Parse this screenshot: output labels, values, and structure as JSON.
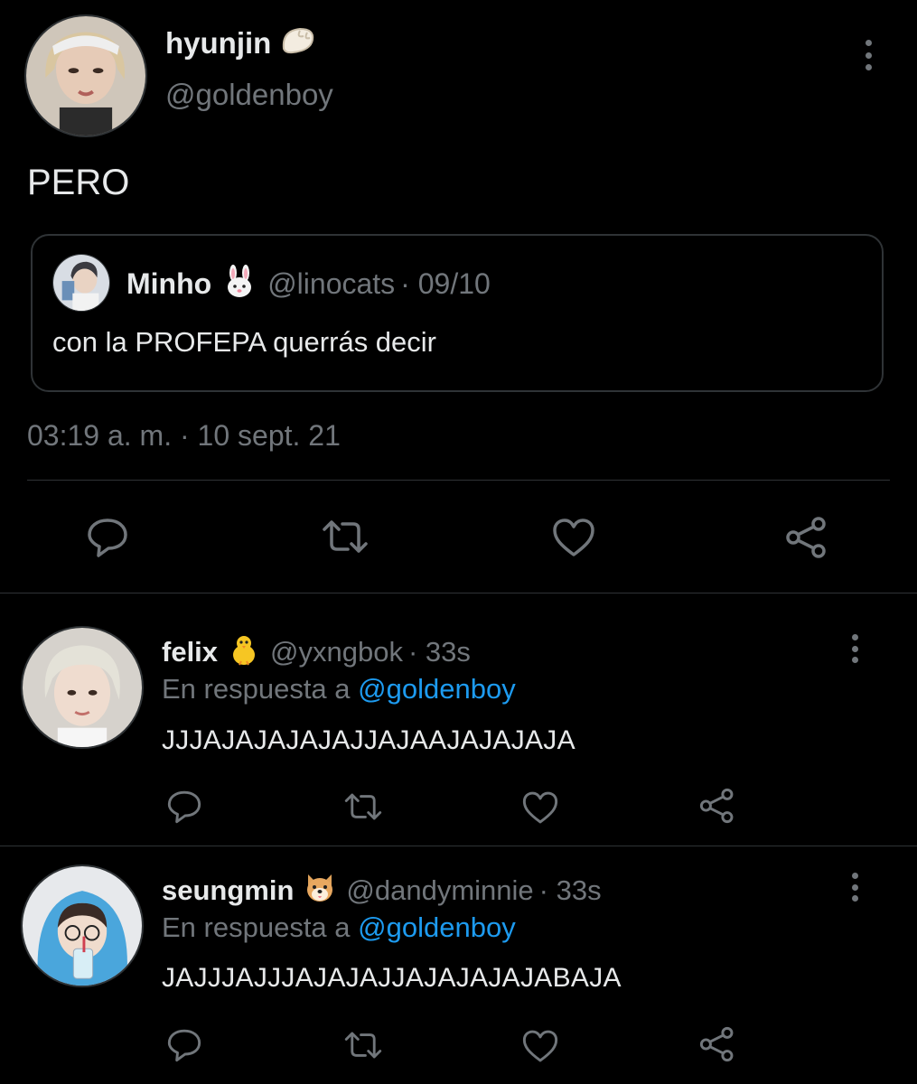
{
  "main_tweet": {
    "display_name": "hyunjin",
    "name_emoji": "dumpling",
    "handle": "@goldenboy",
    "text": "PERO",
    "quote": {
      "display_name": "Minho",
      "name_emoji": "rabbit-face",
      "handle": "@linocats",
      "date": "· 09/10",
      "text": "con la PROFEPA querrás decir"
    },
    "timestamp": "03:19 a. m. · 10 sept. 21",
    "actions": [
      "reply-icon",
      "retweet-icon",
      "like-icon",
      "share-icon"
    ]
  },
  "replies": [
    {
      "display_name": "felix",
      "name_emoji": "baby-chick",
      "handle": "@yxngbok",
      "time": "· 33s",
      "reply_prefix": "En respuesta a",
      "reply_to": "@goldenboy",
      "text": "JJJAJAJAJAJAJJAJAAJAJAJAJA"
    },
    {
      "display_name": "seungmin",
      "name_emoji": "dog-face",
      "handle": "@dandyminnie",
      "time": "· 33s",
      "reply_prefix": "En respuesta a",
      "reply_to": "@goldenboy",
      "text": "JAJJJAJJJAJAJAJJAJAJAJAJABAJA"
    }
  ],
  "colors": {
    "background": "#000000",
    "text": "#e7e9ea",
    "muted": "#71767b",
    "link": "#1d9bf0",
    "border": "#2f3336"
  }
}
